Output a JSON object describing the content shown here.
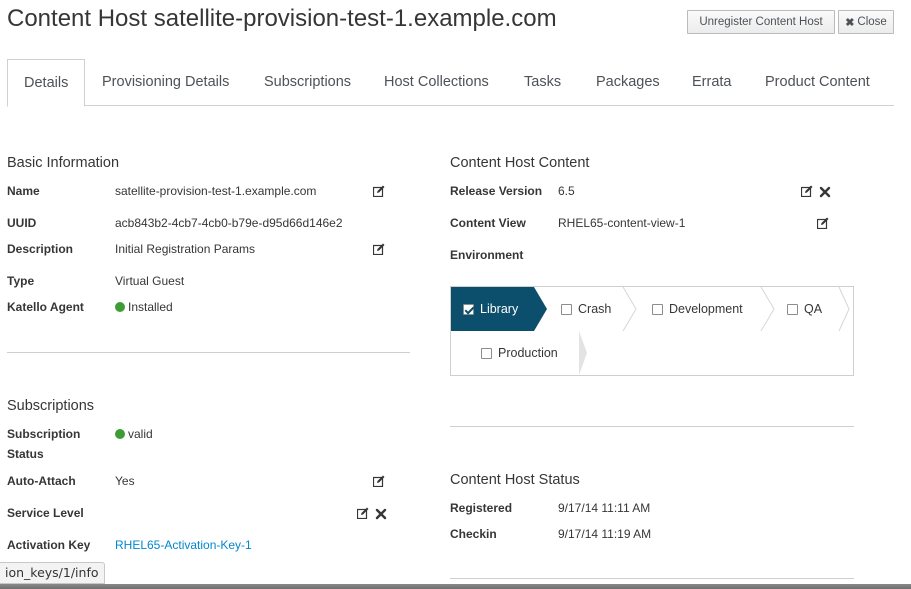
{
  "header": {
    "title": "Content Host satellite-provision-test-1.example.com",
    "unregister_label": "Unregister Content Host",
    "close_label": "Close"
  },
  "tabs": [
    {
      "label": "Details",
      "active": true
    },
    {
      "label": "Provisioning Details"
    },
    {
      "label": "Subscriptions"
    },
    {
      "label": "Host Collections"
    },
    {
      "label": "Tasks"
    },
    {
      "label": "Packages"
    },
    {
      "label": "Errata"
    },
    {
      "label": "Product Content"
    }
  ],
  "basic_info": {
    "title": "Basic Information",
    "name_label": "Name",
    "name_value": "satellite-provision-test-1.example.com",
    "uuid_label": "UUID",
    "uuid_value": "acb843b2-4cb7-4cb0-b79e-d95d66d146e2",
    "description_label": "Description",
    "description_value": "Initial Registration Params",
    "type_label": "Type",
    "type_value": "Virtual Guest",
    "agent_label": "Katello Agent",
    "agent_value": "Installed"
  },
  "subscriptions": {
    "title": "Subscriptions",
    "status_label_1": "Subscription",
    "status_label_2": "Status",
    "status_value": "valid",
    "auto_attach_label": "Auto-Attach",
    "auto_attach_value": "Yes",
    "service_level_label": "Service Level",
    "service_level_value": "",
    "activation_key_label": "Activation Key",
    "activation_key_value": "RHEL65-Activation-Key-1"
  },
  "content": {
    "title": "Content Host Content",
    "release_label": "Release Version",
    "release_value": "6.5",
    "content_view_label": "Content View",
    "content_view_value": "RHEL65-content-view-1",
    "environment_label": "Environment",
    "environments": [
      {
        "label": "Library",
        "checked": true
      },
      {
        "label": "Crash",
        "checked": false
      },
      {
        "label": "Development",
        "checked": false
      },
      {
        "label": "QA",
        "checked": false
      },
      {
        "label": "Production",
        "checked": false
      }
    ]
  },
  "status": {
    "title": "Content Host Status",
    "registered_label": "Registered",
    "registered_value": "9/17/14 11:11 AM",
    "checkin_label": "Checkin",
    "checkin_value": "9/17/14 11:19 AM"
  },
  "browser": {
    "status_url": "ion_keys/1/info"
  },
  "colors": {
    "active_env": "#0b4f6c",
    "ok_dot": "#3f9c35",
    "link": "#0088ce"
  }
}
